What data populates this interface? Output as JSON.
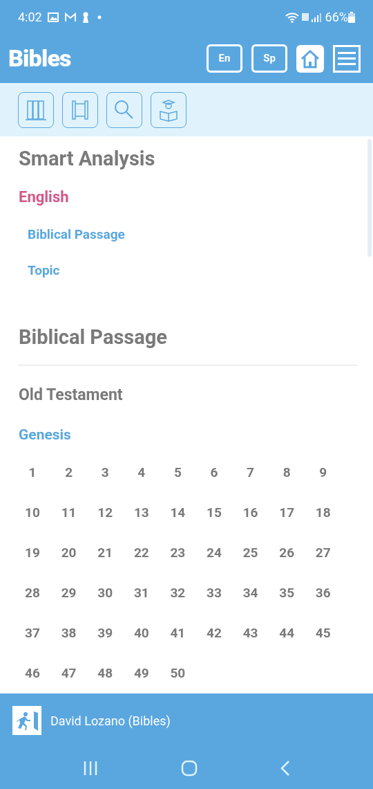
{
  "status_bar": {
    "time": "4:02",
    "battery": "66%"
  },
  "header": {
    "title": "Bibles",
    "language_buttons": [
      "En",
      "Sp"
    ]
  },
  "smart_analysis": {
    "title": "Smart Analysis",
    "language": "English",
    "links": [
      "Biblical Passage",
      "Topic"
    ]
  },
  "biblical_passage": {
    "title": "Biblical Passage",
    "testament": "Old Testament",
    "book": "Genesis",
    "chapters": [
      "1",
      "2",
      "3",
      "4",
      "5",
      "6",
      "7",
      "8",
      "9",
      "10",
      "11",
      "12",
      "13",
      "14",
      "15",
      "16",
      "17",
      "18",
      "19",
      "20",
      "21",
      "22",
      "23",
      "24",
      "25",
      "26",
      "27",
      "28",
      "29",
      "30",
      "31",
      "32",
      "33",
      "34",
      "35",
      "36",
      "37",
      "38",
      "39",
      "40",
      "41",
      "42",
      "43",
      "44",
      "45",
      "46",
      "47",
      "48",
      "49",
      "50"
    ]
  },
  "footer": {
    "user": "David Lozano (Bibles)"
  }
}
